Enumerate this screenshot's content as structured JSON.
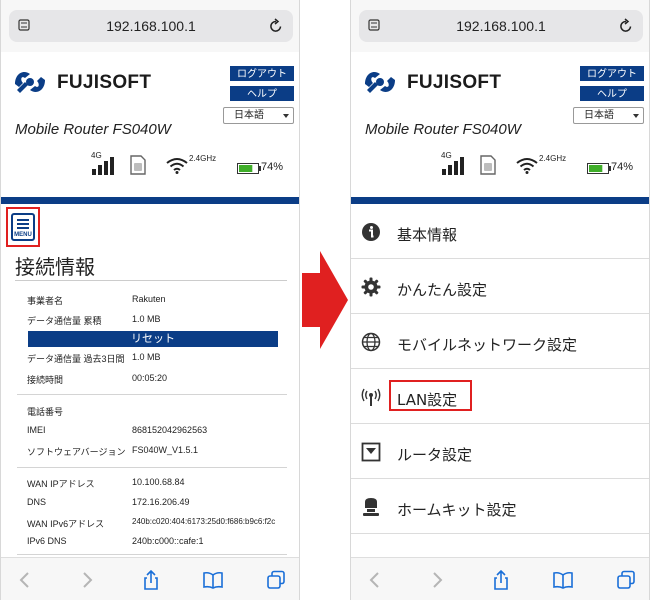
{
  "browser": {
    "url": "192.168.100.1"
  },
  "header": {
    "brand": "FUJISOFT",
    "logout_label": "ログアウト",
    "help_label": "ヘルプ",
    "language": "日本語",
    "product": "Mobile Router FS040W",
    "signal_label": "4G",
    "wifi_label": "2.4GHz",
    "battery_label": "74%",
    "battery_level": 0.74
  },
  "left": {
    "menu_text": "MENU",
    "title": "接続情報",
    "rows": [
      {
        "label": "事業者名",
        "value": "Rakuten"
      },
      {
        "label": "データ通信量 累積",
        "value": "1.0 MB"
      },
      {
        "label": "データ通信量 過去3日間",
        "value": "1.0 MB"
      },
      {
        "label": "接続時間",
        "value": "00:05:20"
      },
      {
        "label": "電話番号",
        "value": ""
      },
      {
        "label": "IMEI",
        "value": "868152042962563"
      },
      {
        "label": "ソフトウェアバージョン",
        "value": "FS040W_V1.5.1"
      },
      {
        "label": "WAN IPアドレス",
        "value": "10.100.68.84"
      },
      {
        "label": "DNS",
        "value": "172.16.206.49"
      },
      {
        "label": "WAN IPv6アドレス",
        "value": "240b:c020:404:6173:25d0:f686:b9c6:f2c"
      },
      {
        "label": "IPv6 DNS",
        "value": "240b:c000::cafe:1"
      }
    ],
    "reset_label": "リセット"
  },
  "right": {
    "menu_items": [
      {
        "label": "基本情報",
        "icon": "info-icon"
      },
      {
        "label": "かんたん設定",
        "icon": "gear-icon"
      },
      {
        "label": "モバイルネットワーク設定",
        "icon": "globe-icon"
      },
      {
        "label": "LAN設定",
        "icon": "antenna-icon"
      },
      {
        "label": "ルータ設定",
        "icon": "router-icon"
      },
      {
        "label": "ホームキット設定",
        "icon": "homekit-icon"
      }
    ]
  },
  "colors": {
    "brand_blue": "#0b3d86",
    "highlight_red": "#e02020",
    "arrow_red": "#e02020",
    "battery_green": "#3fae29"
  }
}
